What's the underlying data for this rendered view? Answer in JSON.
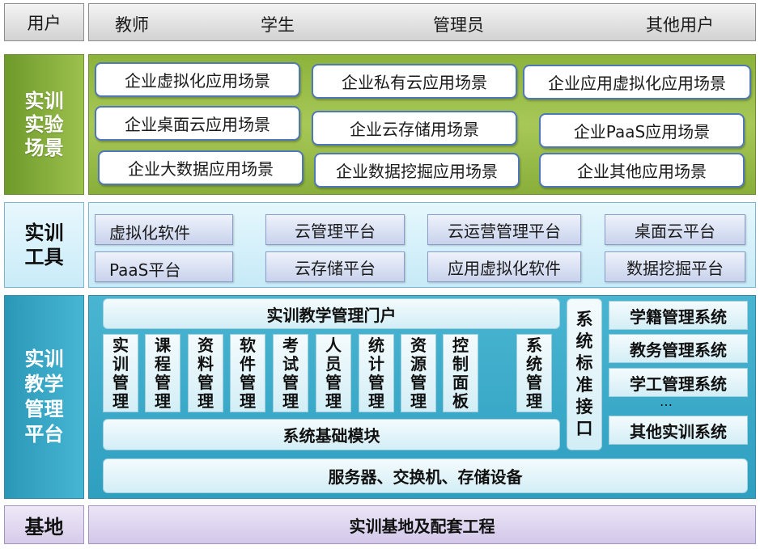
{
  "users": {
    "label": "用户",
    "roles": [
      "教师",
      "学生",
      "管理员",
      "其他用户"
    ]
  },
  "scenarios": {
    "label": "实训实验场景",
    "items": [
      "企业虚拟化应用场景",
      "企业私有云应用场景",
      "企业应用虚拟化应用场景",
      "企业桌面云应用场景",
      "企业云存储用场景",
      "企业PaaS应用场景",
      "企业大数据应用场景",
      "企业数据挖掘应用场景",
      "企业其他应用场景"
    ]
  },
  "tools": {
    "label": "实训工具",
    "items": [
      "虚拟化软件",
      "云管理平台",
      "云运营管理平台",
      "桌面云平台",
      "PaaS平台",
      "云存储平台",
      "应用虚拟化软件",
      "数据挖掘平台"
    ]
  },
  "platform": {
    "label": "实训教学管理平台",
    "portal": "实训教学管理门户",
    "modules": [
      "实训管理",
      "课程管理",
      "资料管理",
      "软件管理",
      "考试管理",
      "人员管理",
      "统计管理",
      "资源管理",
      "控制面板",
      "系统管理"
    ],
    "foundation": "系统基础模块",
    "interface": "系统标准接口",
    "external_systems": [
      "学籍管理系统",
      "教务管理系统",
      "学工管理系统",
      "其他实训系统"
    ],
    "ellipsis": "…",
    "infrastructure": "服务器、交换机、存储设备"
  },
  "base": {
    "label": "基地",
    "content": "实训基地及配套工程"
  }
}
